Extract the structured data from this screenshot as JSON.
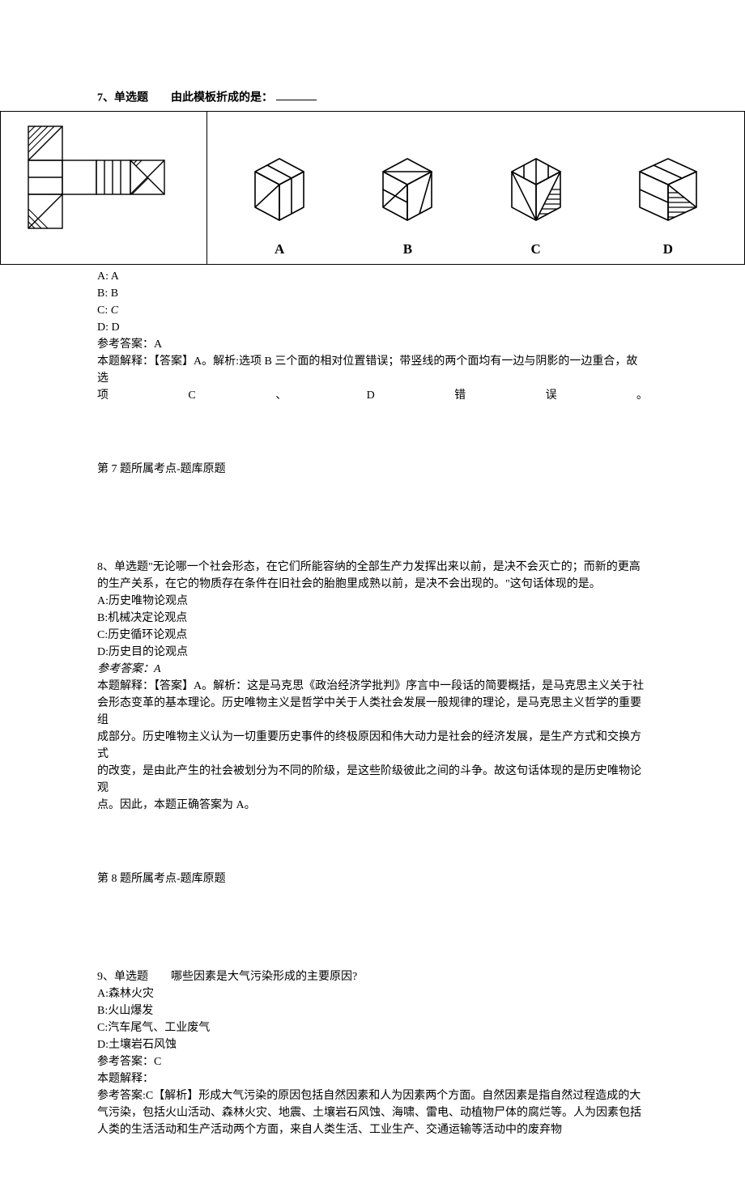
{
  "q7": {
    "header": "7、单选题　　由此模板折成的是：",
    "labels": {
      "A": "A",
      "B": "B",
      "C": "C",
      "D": "D"
    },
    "opts": {
      "A": "A: A",
      "B": "B: B",
      "C": "C",
      "D": "D: D"
    },
    "optC_prefix": "C: ",
    "ans": "参考答案：A",
    "explain_line1": "本题解释：【答案】A。解析:选项 B 三个面的相对位置错误；带竖线的两个面均有一边与阴影的一边重合，故选",
    "spread": {
      "a": "项",
      "b": "C",
      "c": "、",
      "d": "D",
      "e": "错",
      "f": "误",
      "g": "。"
    },
    "footer": "第 7 题所属考点-题库原题"
  },
  "q8": {
    "stem1": "8、单选题\"无论哪一个社会形态，在它们所能容纳的全部生产力发挥出来以前，是决不会灭亡的；而新的更高",
    "stem2": "的生产关系，在它的物质存在条件在旧社会的胎胞里成熟以前，是决不会出现的。\"这句话体现的是。",
    "A": "A:历史唯物论观点",
    "B": "B:机械决定论观点",
    "C": "C:历史循环论观点",
    "D": "D:历史目的论观点",
    "ans": "参考答案：A",
    "exp1": "本题解释：【答案】A。解析：这是马克思《政治经济学批判》序言中一段话的简要概括，是马克思主义关于社",
    "exp2": "会形态变革的基本理论。历史唯物主义是哲学中关于人类社会发展一般规律的理论，是马克思主义哲学的重要组",
    "exp3": "成部分。历史唯物主义认为一切重要历史事件的终极原因和伟大动力是社会的经济发展，是生产方式和交换方式",
    "exp4": "的改变，是由此产生的社会被划分为不同的阶级，是这些阶级彼此之间的斗争。故这句话体现的是历史唯物论观",
    "exp5": "点。因此，本题正确答案为 A。",
    "footer": "第 8 题所属考点-题库原题"
  },
  "q9": {
    "stem": "9、单选题　　哪些因素是大气污染形成的主要原因?",
    "A": "A:森林火灾",
    "B": "B:火山爆发",
    "C": "C:汽车尾气、工业废气",
    "D": "D:土壤岩石风蚀",
    "ans": "参考答案：C",
    "exp0": "本题解释：",
    "exp1": "参考答案:C【解析】形成大气污染的原因包括自然因素和人为因素两个方面。自然因素是指自然过程造成的大",
    "exp2": "气污染，包括火山活动、森林火灾、地震、土壤岩石风蚀、海啸、雷电、动植物尸体的腐烂等。人为因素包括",
    "exp3": "人类的生活活动和生产活动两个方面，来自人类生活、工业生产、交通运输等活动中的废弃物"
  }
}
